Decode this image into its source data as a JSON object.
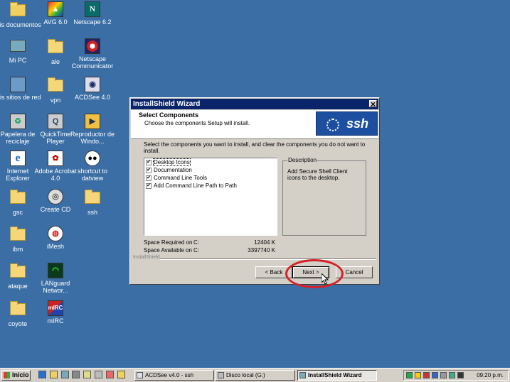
{
  "desktop": {
    "icons": [
      {
        "label": "Mis documentos",
        "icon": "my-documents-icon"
      },
      {
        "label": "AVG 6.0",
        "icon": "avg-icon"
      },
      {
        "label": "Netscape 6.2",
        "icon": "netscape-icon"
      },
      {
        "label": "Mi PC",
        "icon": "my-computer-icon"
      },
      {
        "label": "ale",
        "icon": "folder-icon"
      },
      {
        "label": "Netscape Communicator",
        "icon": "netscape-communicator-icon"
      },
      {
        "label": "Mis sitios de red",
        "icon": "network-places-icon"
      },
      {
        "label": "vpn",
        "icon": "folder-icon"
      },
      {
        "label": "ACDSee 4.0",
        "icon": "acdsee-icon"
      },
      {
        "label": "Papelera de reciclaje",
        "icon": "recycle-bin-icon"
      },
      {
        "label": "QuickTime Player",
        "icon": "quicktime-icon"
      },
      {
        "label": "Reproductor de Windo...",
        "icon": "media-player-icon"
      },
      {
        "label": "Internet Explorer",
        "icon": "internet-explorer-icon"
      },
      {
        "label": "Adobe Acrobat 4.0",
        "icon": "acrobat-icon"
      },
      {
        "label": "shortcut to datview",
        "icon": "datview-icon"
      },
      {
        "label": "gsc",
        "icon": "folder-icon"
      },
      {
        "label": "Create CD",
        "icon": "create-cd-icon"
      },
      {
        "label": "ssh",
        "icon": "folder-icon"
      },
      {
        "label": "ibm",
        "icon": "folder-icon"
      },
      {
        "label": "iMesh",
        "icon": "imesh-icon"
      },
      {
        "label": "ataque",
        "icon": "folder-icon"
      },
      {
        "label": "LANguard Networ...",
        "icon": "languard-icon"
      },
      {
        "label": "coyote",
        "icon": "folder-icon"
      },
      {
        "label": "mIRC",
        "icon": "mirc-icon"
      }
    ]
  },
  "dialog": {
    "title": "InstallShield Wizard",
    "close_glyph": "✕",
    "header_title": "Select Components",
    "header_subtitle": "Choose the components Setup will install.",
    "logo_text": "ssh",
    "instruction": "Select the components you want to install, and clear the components you do not want to install.",
    "components": [
      {
        "label": "Desktop Icons",
        "checked": true,
        "selected": true
      },
      {
        "label": "Documentation",
        "checked": true,
        "selected": false
      },
      {
        "label": "Command Line Tools",
        "checked": true,
        "selected": false
      },
      {
        "label": "Add Command Line Path to Path",
        "checked": true,
        "selected": false
      }
    ],
    "check_glyph": "✔",
    "description_label": "Description",
    "description_text": "Add Secure Shell Client icons to the desktop.",
    "space_required_label": "Space Required on",
    "space_required_drive": "C:",
    "space_required_value": "12404 K",
    "space_available_label": "Space Available on",
    "space_available_drive": "C:",
    "space_available_value": "3397740 K",
    "brand": "InstallShield",
    "back_label": "< Back",
    "next_label": "Next >",
    "cancel_label": "Cancel",
    "highlight_color": "#d2232a"
  },
  "taskbar": {
    "start_label": "Inicio",
    "tasks": [
      {
        "label": "ACDSee v4.0 - ssh",
        "active": false
      },
      {
        "label": "Disco local (G:)",
        "active": false
      },
      {
        "label": "InstallShield Wizard",
        "active": true
      }
    ],
    "clock": "09:20 p.m."
  }
}
